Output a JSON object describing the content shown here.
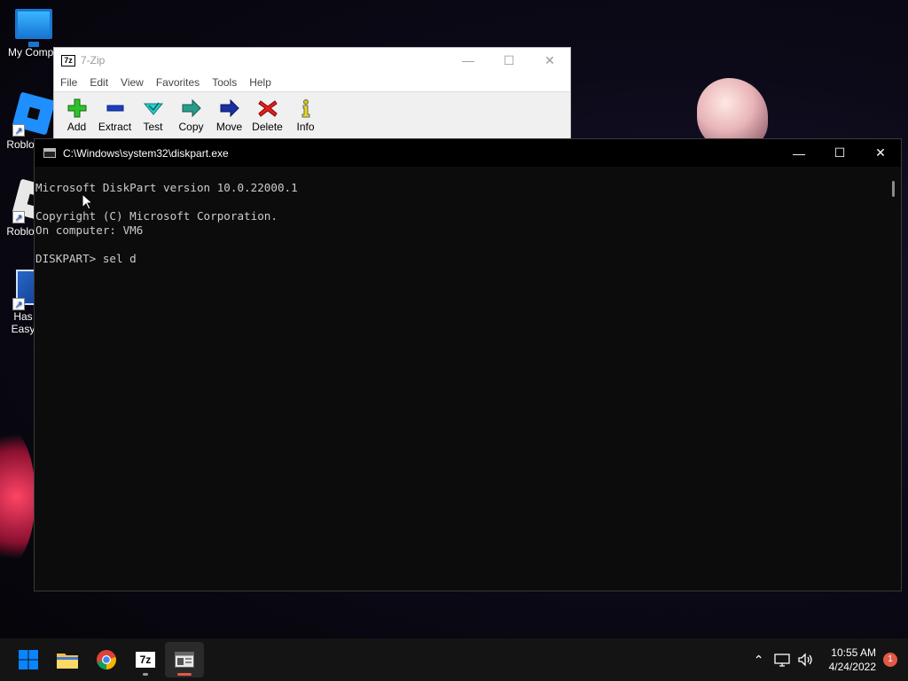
{
  "desktop": {
    "icons": [
      {
        "label": "My Compu"
      },
      {
        "label": "Roblox"
      },
      {
        "label": "Roblox"
      },
      {
        "label": "Has\nEasy"
      }
    ]
  },
  "zip": {
    "title": "7-Zip",
    "logo_text": "7z",
    "menu": [
      "File",
      "Edit",
      "View",
      "Favorites",
      "Tools",
      "Help"
    ],
    "tools": [
      "Add",
      "Extract",
      "Test",
      "Copy",
      "Move",
      "Delete",
      "Info"
    ]
  },
  "console": {
    "title": "C:\\Windows\\system32\\diskpart.exe",
    "lines": [
      "Microsoft DiskPart version 10.0.22000.1",
      "",
      "Copyright (C) Microsoft Corporation.",
      "On computer: VM6",
      "",
      "DISKPART> sel d"
    ]
  },
  "taskbar": {
    "time": "10:55 AM",
    "date": "4/24/2022",
    "notification_count": "1",
    "zip_logo_text": "7z"
  },
  "colors": {
    "accent": "#0a84ff",
    "console_bg": "#0c0c0c",
    "console_text": "#cccccc",
    "notification": "#e05a47"
  }
}
